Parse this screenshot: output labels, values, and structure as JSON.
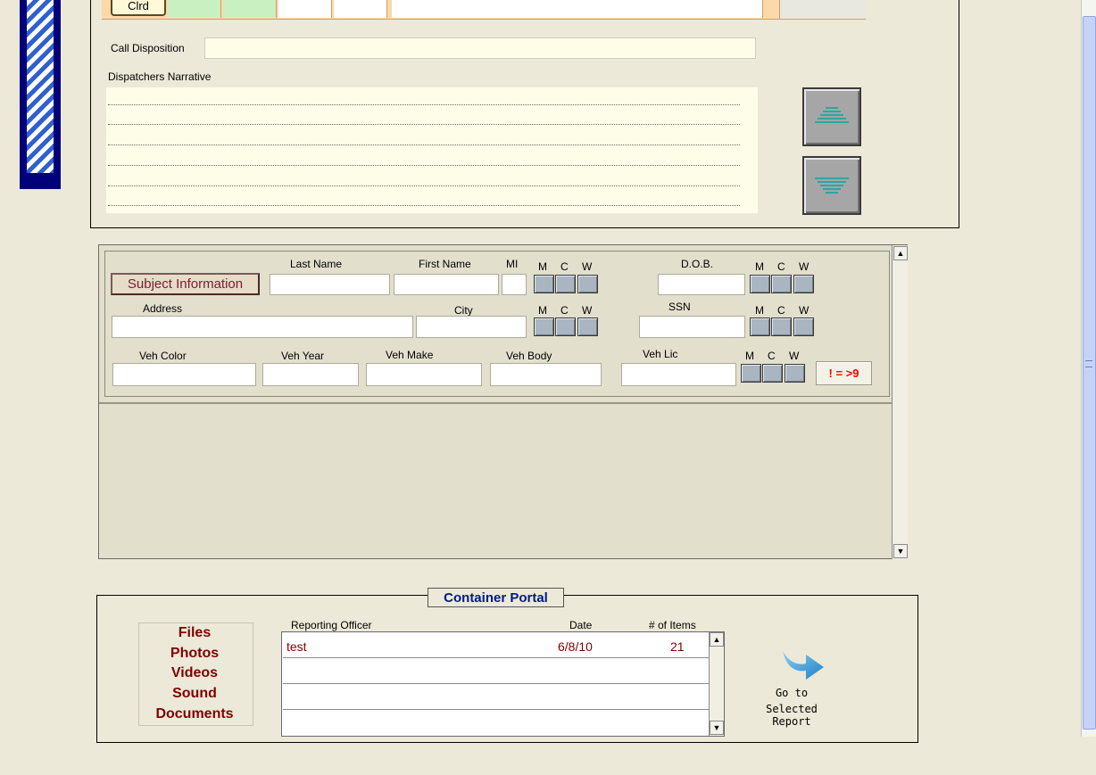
{
  "top_strip": {
    "cell_label": "Clrd"
  },
  "call_disposition": {
    "label": "Call Disposition",
    "value": ""
  },
  "narrative": {
    "label": "Dispatchers Narrative",
    "lines": 7
  },
  "subject": {
    "button_label": "Subject Information",
    "labels": {
      "last_name": "Last Name",
      "first_name": "First Name",
      "mi": "MI",
      "dob": "D.O.B.",
      "address": "Address",
      "city": "City",
      "ssn": "SSN",
      "veh_color": "Veh Color",
      "veh_year": "Veh Year",
      "veh_make": "Veh Make",
      "veh_body": "Veh Body",
      "veh_lic": "Veh Lic"
    },
    "mcw": {
      "m": "M",
      "c": "C",
      "w": "W"
    },
    "flag_button": "! = >9"
  },
  "portal": {
    "title": "Container Portal",
    "links": [
      "Files",
      "Photos",
      "Videos",
      "Sound",
      "Documents"
    ],
    "columns": {
      "officer": "Reporting Officer",
      "date": "Date",
      "items": "# of Items"
    },
    "rows": [
      {
        "officer": "test",
        "date": "6/8/10",
        "items": "21"
      }
    ],
    "go_label": "Go to",
    "go_label2": "Selected Report"
  },
  "colors": {
    "accent_navy": "#00007a",
    "dark_red": "#800000",
    "flag_red": "#ff0000",
    "arrow_teal": "#2aa6a6"
  }
}
